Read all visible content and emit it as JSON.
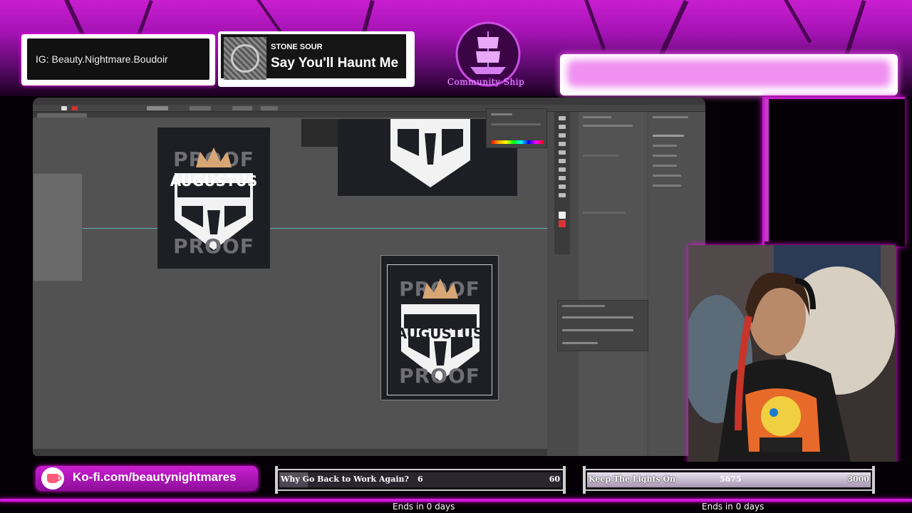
{
  "overlay": {
    "instagram": "IG: Beauty.Nightmare.Boudoir",
    "now_playing": {
      "artist": "STONE SOUR",
      "track": "Say You'll Haunt Me"
    },
    "brand": "Community Ship",
    "kofi": "Ko-fi.com/beautynightmares"
  },
  "artboards": {
    "proof_top": "PROOF",
    "proof_bottom": "PROOF",
    "shield_name": "AUGUSTUS"
  },
  "goals": [
    {
      "title": "Why Go Back to Work Again?",
      "current": "6",
      "target": "60",
      "progress": 0.1,
      "ends": "Ends in 0 days"
    },
    {
      "title": "Keep The Lights On",
      "current": "5675",
      "target": "3000",
      "progress": 1.0,
      "ends": "Ends in 0 days"
    }
  ],
  "colors": {
    "accent": "#c91ed0",
    "goal_fill": "#d8cfe0"
  }
}
